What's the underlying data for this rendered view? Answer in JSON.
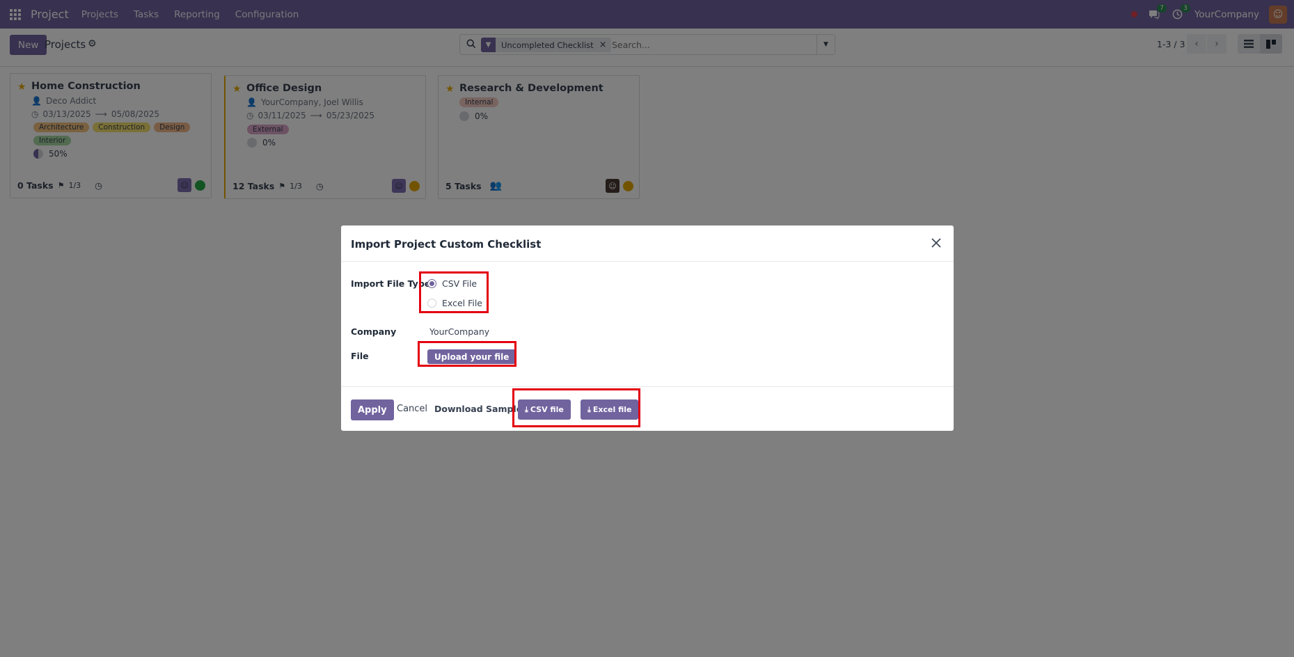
{
  "navbar": {
    "app_name": "Project",
    "menu": [
      "Projects",
      "Tasks",
      "Reporting",
      "Configuration"
    ],
    "messages_badge": "7",
    "activities_badge": "3",
    "company": "YourCompany"
  },
  "control": {
    "new_label": "New",
    "title": "Projects",
    "facet": "Uncompleted Checklist",
    "search_placeholder": "Search...",
    "pager": "1-3 / 3"
  },
  "cards": [
    {
      "title": "Home Construction",
      "customer": "Deco Addict",
      "date_start": "03/13/2025",
      "date_end": "05/08/2025",
      "tags": [
        {
          "label": "Architecture",
          "color": "#f4c27f"
        },
        {
          "label": "Construction",
          "color": "#f5e16f"
        },
        {
          "label": "Design",
          "color": "#f3b98a"
        },
        {
          "label": "Interior",
          "color": "#a7d8a2"
        }
      ],
      "progress": "50%",
      "tasks": "0 Tasks",
      "milestones": "1/3",
      "status_color": "#28a745"
    },
    {
      "title": "Office Design",
      "customer": "YourCompany, Joel Willis",
      "date_start": "03/11/2025",
      "date_end": "05/23/2025",
      "tags": [
        {
          "label": "External",
          "color": "#dba4c8"
        }
      ],
      "progress": "0%",
      "tasks": "12 Tasks",
      "milestones": "1/3",
      "status_color": "#e4a900"
    },
    {
      "title": "Research & Development",
      "tags": [
        {
          "label": "Internal",
          "color": "#f3c9c0"
        }
      ],
      "progress": "0%",
      "tasks": "5 Tasks",
      "status_color": "#e4a900"
    }
  ],
  "modal": {
    "title": "Import Project Custom Checklist",
    "file_type_label": "Import File Type",
    "options": [
      "CSV File",
      "Excel File"
    ],
    "selected_option": "CSV File",
    "company_label": "Company",
    "company_value": "YourCompany",
    "file_label": "File",
    "upload_label": "Upload your file",
    "apply_label": "Apply",
    "cancel_label": "Cancel",
    "download_label": "Download Sample:",
    "csv_sample_label": "CSV file",
    "excel_sample_label": "Excel file"
  },
  "colors": {
    "brand": "#71639e",
    "highlight": "#e3000f"
  }
}
